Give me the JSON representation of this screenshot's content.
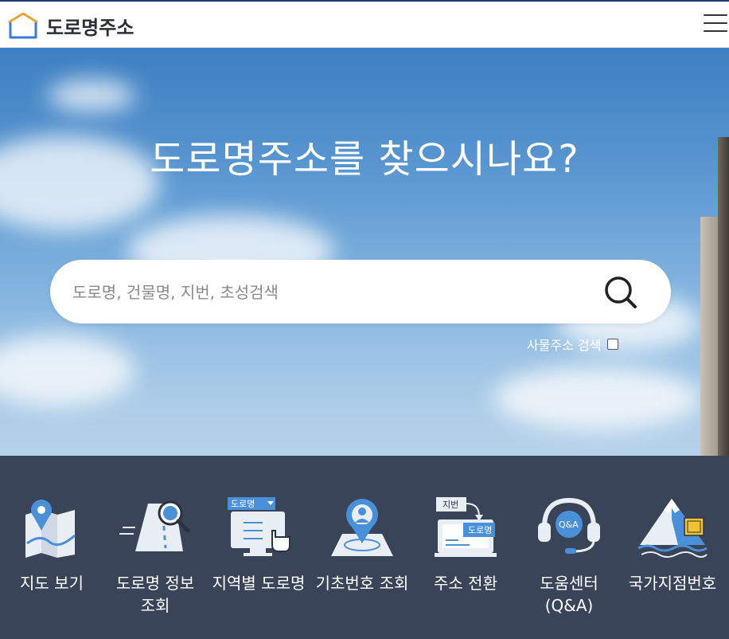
{
  "header": {
    "logo_text": "도로명주소",
    "menu_icon": "hamburger-icon"
  },
  "hero": {
    "title": "도로명주소를 찾으시나요?",
    "search": {
      "placeholder": "도로명, 건물명, 지번, 초성검색",
      "value": "",
      "button_icon": "search-icon"
    },
    "business_search_label": "사물주소 검색",
    "business_search_checked": false
  },
  "quick_menu": [
    {
      "label": "지도 보기",
      "icon": "map-pin-icon"
    },
    {
      "label": "도로명 정보 조회",
      "icon": "road-magnifier-icon",
      "badge": ""
    },
    {
      "label": "지역별 도로명",
      "icon": "monitor-select-icon",
      "badge": "도로명"
    },
    {
      "label": "기초번호 조회",
      "icon": "location-person-icon"
    },
    {
      "label": "주소 전환",
      "icon": "address-convert-icon",
      "badge_top": "지번",
      "badge_bottom": "도로명"
    },
    {
      "label": "도움센터 (Q&A)",
      "icon": "headset-qa-icon",
      "badge": "Q&A"
    },
    {
      "label": "국가지점번호",
      "icon": "mountain-marker-icon"
    }
  ],
  "colors": {
    "header_border": "#1e3a6e",
    "logo_accent": "#3a7bd5",
    "quick_bg": "#3a4458",
    "icon_blue": "#4a90d9"
  }
}
